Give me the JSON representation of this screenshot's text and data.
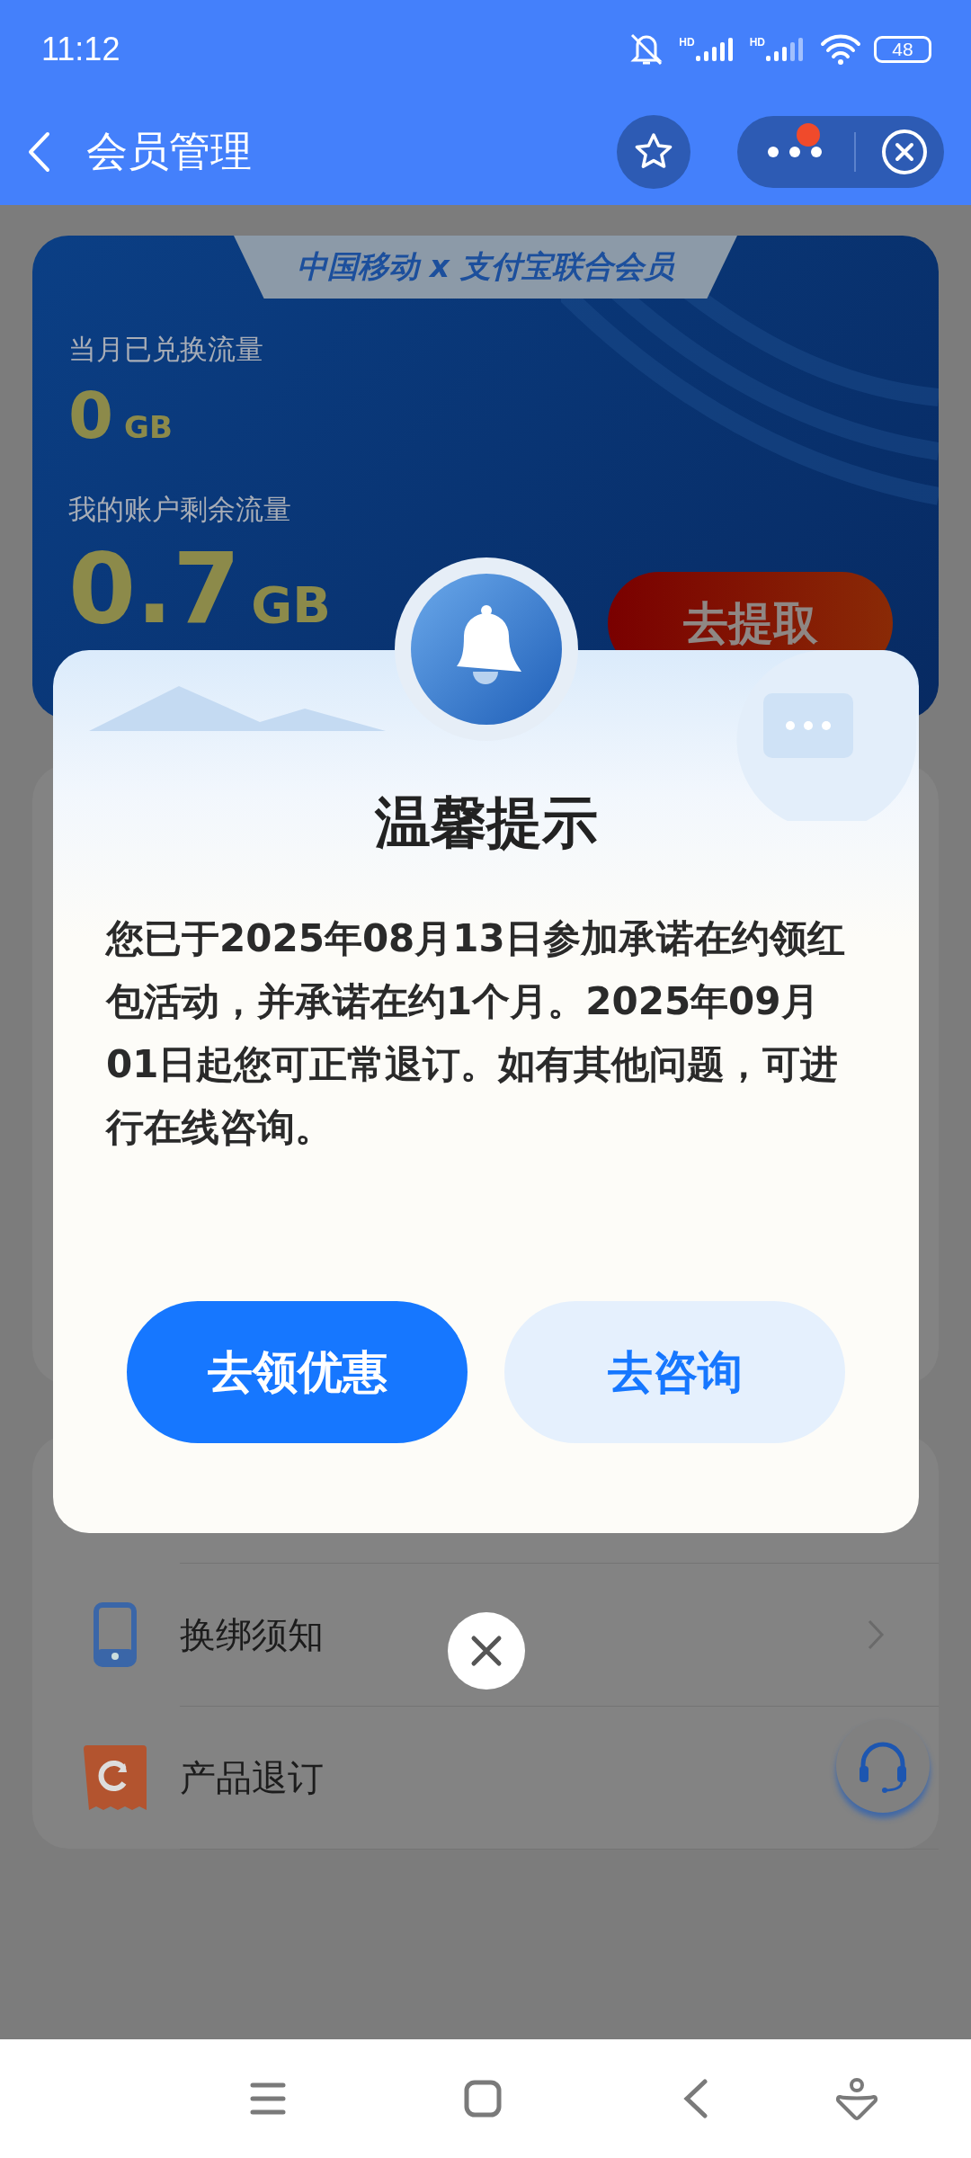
{
  "status_bar": {
    "time": "11:12",
    "signals": [
      {
        "label": "HD",
        "kind": "full"
      },
      {
        "label": "HD",
        "kind": "partial"
      }
    ],
    "battery": "48"
  },
  "header": {
    "title": "会员管理"
  },
  "member_card": {
    "banner": "中国移动 x 支付宝联合会员",
    "stats": [
      {
        "label": "当月已兑换流量",
        "value": "0",
        "unit": "GB"
      },
      {
        "label": "我的账户剩余流量",
        "value": "0.7",
        "unit": "GB"
      }
    ],
    "action": "去提取"
  },
  "dialog": {
    "title": "温馨提示",
    "message": "您已于2025年08月13日参加承诺在约领红包活动，并承诺在约1个月。2025年09月01日起您可正常退订。如有其他问题，可进行在线咨询。",
    "buttons": [
      {
        "label": "去领优惠",
        "kind": "primary"
      },
      {
        "label": "去咨询",
        "kind": "secondary"
      }
    ]
  },
  "list": [
    {
      "label": "换绑须知",
      "kind": "phone"
    },
    {
      "label": "产品退订",
      "kind": "refund"
    }
  ]
}
